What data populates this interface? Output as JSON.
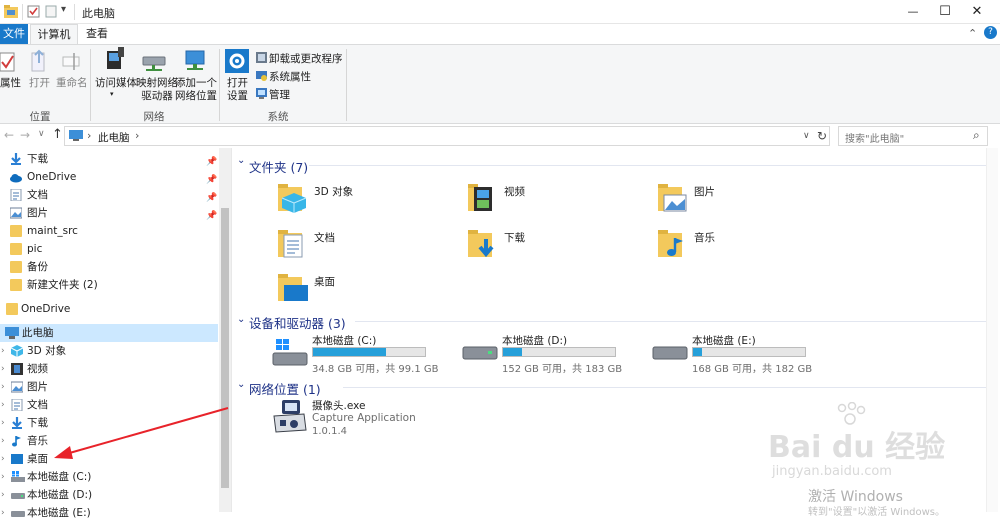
{
  "window": {
    "title": "此电脑",
    "minimize_glyph": "—",
    "maximize_glyph": "☐",
    "close_glyph": "✕",
    "help_glyph": "?"
  },
  "quick_access_toolbar": {
    "dropdown_glyph": "▾"
  },
  "ribbon_tabs": [
    {
      "label": "文件",
      "active_style": "file"
    },
    {
      "label": "计算机",
      "active_style": "selected"
    },
    {
      "label": "查看",
      "active_style": "normal"
    }
  ],
  "ribbon": {
    "groups": [
      {
        "label": "位置",
        "buttons": [
          "属性",
          "打开",
          "重命名"
        ]
      },
      {
        "label": "网络",
        "buttons": [
          "访问媒体",
          "映射网络\n驱动器",
          "添加一个\n网络位置"
        ]
      },
      {
        "label": "系统",
        "buttons": [
          "打开\n设置"
        ],
        "small_buttons": [
          "卸载或更改程序",
          "系统属性",
          "管理"
        ]
      }
    ],
    "collapse_glyph": "⌃"
  },
  "address_bar": {
    "back_glyph": "←",
    "forward_glyph": "→",
    "recent_glyph": "∨",
    "up_glyph": "↑",
    "path_sep": "›",
    "path": [
      "此电脑"
    ],
    "dropdown_glyph": "∨",
    "refresh_glyph": "↻",
    "search_placeholder": "搜索\"此电脑\"",
    "search_glyph": "⌕"
  },
  "nav_pane": {
    "quick_access": [
      {
        "label": "下载",
        "icon": "download-icon",
        "pinned": true
      },
      {
        "label": "OneDrive",
        "icon": "onedrive-cloud-icon",
        "pinned": true
      },
      {
        "label": "文档",
        "icon": "documents-icon",
        "pinned": true
      },
      {
        "label": "图片",
        "icon": "pictures-icon",
        "pinned": true
      },
      {
        "label": "maint_src",
        "icon": "folder-icon",
        "pinned": false
      },
      {
        "label": "pic",
        "icon": "folder-icon",
        "pinned": false
      },
      {
        "label": "备份",
        "icon": "folder-icon",
        "pinned": false
      },
      {
        "label": "新建文件夹 (2)",
        "icon": "folder-icon",
        "pinned": false
      }
    ],
    "onedrive": {
      "label": "OneDrive",
      "icon": "onedrive-folder-icon"
    },
    "this_pc": {
      "label": "此电脑",
      "icon": "computer-icon",
      "selected": true
    },
    "this_pc_children": [
      {
        "label": "3D 对象",
        "icon": "3d-objects-icon"
      },
      {
        "label": "视频",
        "icon": "videos-icon"
      },
      {
        "label": "图片",
        "icon": "pictures-icon"
      },
      {
        "label": "文档",
        "icon": "documents-icon"
      },
      {
        "label": "下载",
        "icon": "download-icon"
      },
      {
        "label": "音乐",
        "icon": "music-icon"
      },
      {
        "label": "桌面",
        "icon": "desktop-icon"
      },
      {
        "label": "本地磁盘 (C:)",
        "icon": "windows-drive-icon"
      },
      {
        "label": "本地磁盘 (D:)",
        "icon": "drive-icon"
      },
      {
        "label": "本地磁盘 (E:)",
        "icon": "drive-icon"
      }
    ],
    "expand_glyph": "›",
    "pin_glyph": "📌"
  },
  "content": {
    "folders_section": {
      "header": "文件夹 (7)",
      "collapse_glyph": "⌄",
      "items": [
        {
          "label": "3D 对象",
          "icon": "3d-objects-folder-icon"
        },
        {
          "label": "视频",
          "icon": "videos-folder-icon"
        },
        {
          "label": "图片",
          "icon": "pictures-folder-icon"
        },
        {
          "label": "文档",
          "icon": "documents-folder-icon"
        },
        {
          "label": "下载",
          "icon": "downloads-folder-icon"
        },
        {
          "label": "音乐",
          "icon": "music-folder-icon"
        },
        {
          "label": "桌面",
          "icon": "desktop-folder-icon"
        }
      ]
    },
    "drives_section": {
      "header": "设备和驱动器 (3)",
      "collapse_glyph": "⌄",
      "drives": [
        {
          "label": "本地磁盘 (C:)",
          "free_text": "34.8 GB 可用，共 99.1 GB",
          "used_fraction": 0.65,
          "icon": "windows-drive-icon"
        },
        {
          "label": "本地磁盘 (D:)",
          "free_text": "152 GB 可用，共 183 GB",
          "used_fraction": 0.17,
          "icon": "drive-icon"
        },
        {
          "label": "本地磁盘 (E:)",
          "free_text": "168 GB 可用，共 182 GB",
          "used_fraction": 0.08,
          "icon": "drive-icon"
        }
      ]
    },
    "network_section": {
      "header": "网络位置 (1)",
      "collapse_glyph": "⌄",
      "items": [
        {
          "name": "摄像头.exe",
          "description": "Capture Application",
          "version": "1.0.1.4",
          "icon": "camera-app-icon"
        }
      ]
    }
  },
  "overlay": {
    "annotation_arrow_color": "#e8232a",
    "watermark_brand": "Bai du 经验",
    "watermark_url": "jingyan.baidu.com",
    "activate_windows": "激活 Windows",
    "activate_windows_sub": "转到\"设置\"以激活 Windows。"
  },
  "colors": {
    "accent": "#1979ca",
    "selected_bg": "#cce8ff",
    "drive_fill": "#26a0da",
    "folder": "#f3c95c"
  }
}
